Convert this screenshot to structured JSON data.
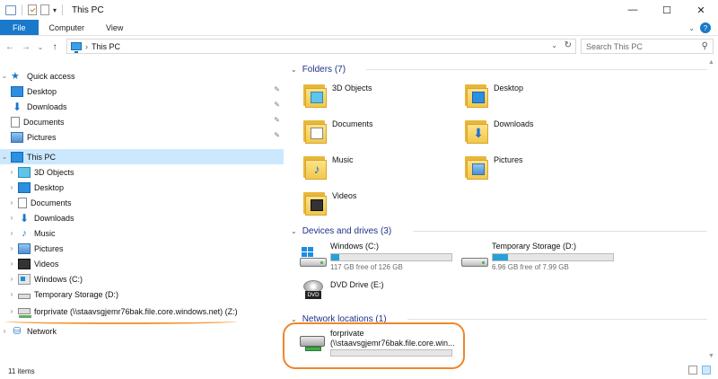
{
  "window": {
    "title": "This PC",
    "controls": {
      "minimize": "—",
      "maximize": "☐",
      "close": "✕"
    }
  },
  "ribbon": {
    "tabs": [
      "File",
      "Computer",
      "View"
    ],
    "expand_glyph": "⌄",
    "help_glyph": "?"
  },
  "address_bar": {
    "back": "←",
    "forward": "→",
    "recent": "⌄",
    "up": "↑",
    "breadcrumb": [
      "This PC"
    ],
    "dropdown_glyph": "⌄",
    "refresh_glyph": "↻"
  },
  "search": {
    "placeholder": "Search This PC",
    "icon": "search-icon"
  },
  "nav_pane": {
    "quick_access": {
      "label": "Quick access",
      "items": [
        {
          "label": "Desktop",
          "icon": "desktop-icon",
          "pinned": true
        },
        {
          "label": "Downloads",
          "icon": "downloads-icon",
          "pinned": true
        },
        {
          "label": "Documents",
          "icon": "documents-icon",
          "pinned": true
        },
        {
          "label": "Pictures",
          "icon": "pictures-icon",
          "pinned": true
        }
      ]
    },
    "this_pc": {
      "label": "This PC",
      "selected": true,
      "items": [
        {
          "label": "3D Objects",
          "icon": "3d-objects-icon"
        },
        {
          "label": "Desktop",
          "icon": "desktop-icon"
        },
        {
          "label": "Documents",
          "icon": "documents-icon"
        },
        {
          "label": "Downloads",
          "icon": "downloads-icon"
        },
        {
          "label": "Music",
          "icon": "music-icon"
        },
        {
          "label": "Pictures",
          "icon": "pictures-icon"
        },
        {
          "label": "Videos",
          "icon": "videos-icon"
        },
        {
          "label": "Windows (C:)",
          "icon": "windows-drive-icon"
        },
        {
          "label": "Temporary Storage (D:)",
          "icon": "drive-icon"
        },
        {
          "label": "forprivate (\\\\staavsgjemr76bak.file.core.windows.net) (Z:)",
          "icon": "network-drive-icon"
        }
      ]
    },
    "network": {
      "label": "Network",
      "icon": "network-icon"
    }
  },
  "content": {
    "folders": {
      "header": "Folders (7)",
      "items": [
        {
          "label": "3D Objects",
          "icon": "3d-objects-folder-icon"
        },
        {
          "label": "Desktop",
          "icon": "desktop-folder-icon"
        },
        {
          "label": "Documents",
          "icon": "documents-folder-icon"
        },
        {
          "label": "Downloads",
          "icon": "downloads-folder-icon"
        },
        {
          "label": "Music",
          "icon": "music-folder-icon"
        },
        {
          "label": "Pictures",
          "icon": "pictures-folder-icon"
        },
        {
          "label": "Videos",
          "icon": "videos-folder-icon"
        }
      ]
    },
    "devices": {
      "header": "Devices and drives (3)",
      "items": [
        {
          "label": "Windows (C:)",
          "free_text": "117 GB free of 126 GB",
          "used_fraction": 0.07,
          "icon": "windows-drive-icon"
        },
        {
          "label": "Temporary Storage (D:)",
          "free_text": "6.96 GB free of 7.99 GB",
          "used_fraction": 0.13,
          "icon": "drive-icon"
        },
        {
          "label": "DVD Drive (E:)",
          "icon": "dvd-drive-icon"
        }
      ]
    },
    "network_locations": {
      "header": "Network locations (1)",
      "items": [
        {
          "label": "forprivate",
          "path": "(\\\\staavsgjemr76bak.file.core.win...",
          "icon": "network-drive-icon"
        }
      ]
    }
  },
  "status_bar": {
    "count": "11 items"
  },
  "colors": {
    "accent": "#1979ca",
    "selection": "#cce8ff",
    "group_header": "#1e3287",
    "drive_bar": "#26a0da",
    "annotation": "#f0862a"
  }
}
